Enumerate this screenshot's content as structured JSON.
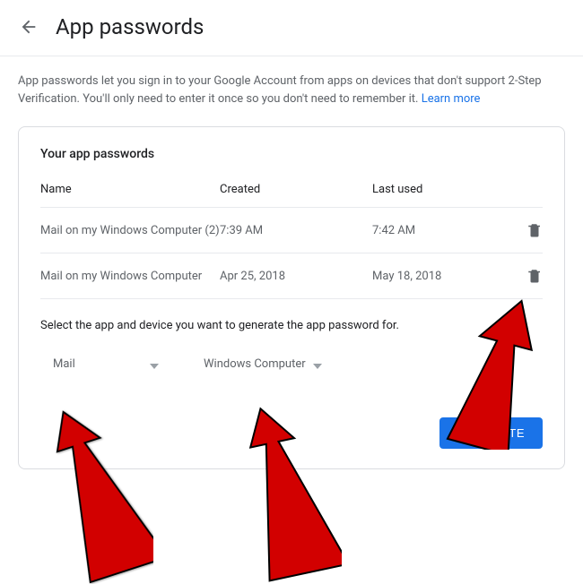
{
  "header": {
    "title": "App passwords"
  },
  "description": {
    "text": "App passwords let you sign in to your Google Account from apps on devices that don't support 2-Step Verification. You'll only need to enter it once so you don't need to remember it. ",
    "learn_more": "Learn more"
  },
  "card": {
    "title": "Your app passwords",
    "columns": {
      "name": "Name",
      "created": "Created",
      "last_used": "Last used"
    },
    "rows": [
      {
        "name": "Mail on my Windows Computer (2)",
        "created": "7:39 AM",
        "last_used": "7:42 AM"
      },
      {
        "name": "Mail on my Windows Computer",
        "created": "Apr 25, 2018",
        "last_used": "May 18, 2018"
      }
    ],
    "select_label": "Select the app and device you want to generate the app password for.",
    "app_select": "Mail",
    "device_select": "Windows Computer",
    "generate_label": "GENERATE"
  }
}
